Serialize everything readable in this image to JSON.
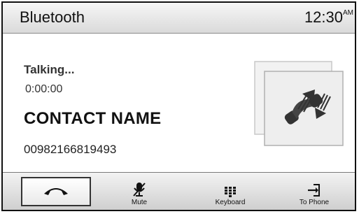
{
  "header": {
    "title": "Bluetooth",
    "time": "12:30",
    "ampm": "AM"
  },
  "call": {
    "status": "Talking...",
    "duration": "0:00:00",
    "contact_name": "CONTACT NAME",
    "phone_number": "00982166819493"
  },
  "footer": {
    "buttons": [
      {
        "label": "",
        "icon": "end-call-icon"
      },
      {
        "label": "Mute",
        "icon": "mic-mute-icon"
      },
      {
        "label": "Keyboard",
        "icon": "keypad-icon"
      },
      {
        "label": "To Phone",
        "icon": "to-phone-icon"
      }
    ]
  }
}
